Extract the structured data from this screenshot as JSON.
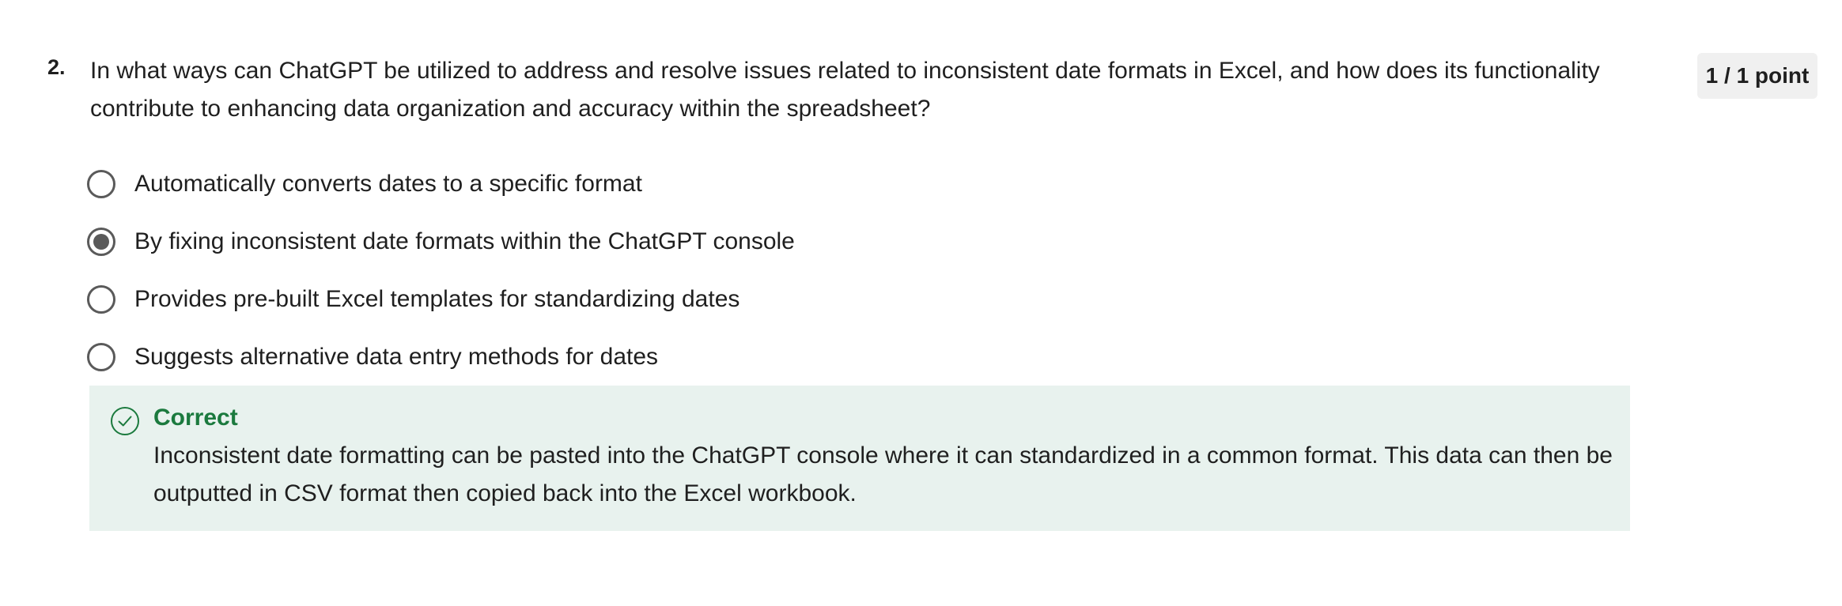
{
  "question": {
    "number": "2.",
    "text": "In what ways can ChatGPT be utilized to address and resolve issues related to inconsistent date formats in Excel, and how does its functionality contribute to enhancing data organization and accuracy within the spreadsheet?",
    "points": "1 / 1 point"
  },
  "options": [
    {
      "label": "Automatically converts dates to a specific format",
      "selected": false
    },
    {
      "label": "By fixing inconsistent date formats within the ChatGPT console",
      "selected": true
    },
    {
      "label": "Provides pre-built Excel templates for standardizing dates",
      "selected": false
    },
    {
      "label": "Suggests alternative data entry methods for dates",
      "selected": false
    }
  ],
  "feedback": {
    "icon": "check-circle-icon",
    "title": "Correct",
    "text": "Inconsistent date formatting can be pasted into the ChatGPT console where it can standardized in a common format. This data can then be outputted in CSV format then copied back into the Excel workbook.",
    "color": "#1b7a3e",
    "background": "#e8f2ee"
  }
}
